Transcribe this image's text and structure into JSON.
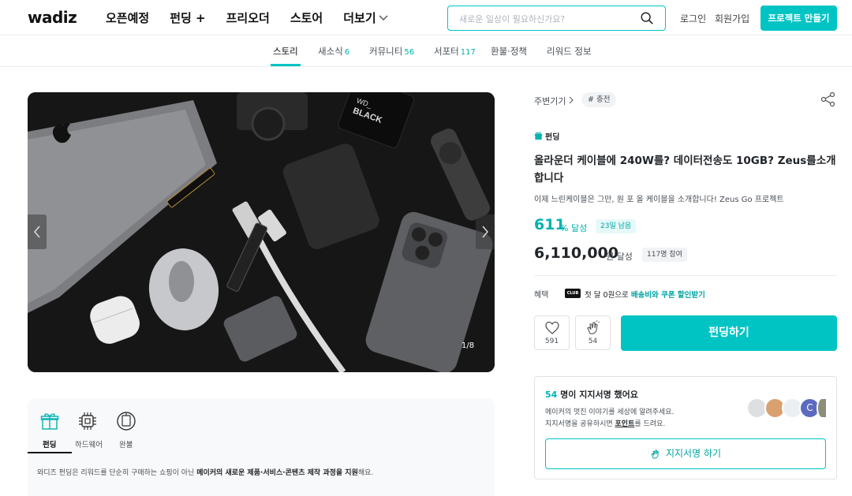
{
  "header": {
    "logo": "wadiz",
    "nav": [
      {
        "label": "오픈예정"
      },
      {
        "label": "펀딩 +"
      },
      {
        "label": "프리오더"
      },
      {
        "label": "스토어"
      },
      {
        "label": "더보기"
      }
    ],
    "search_placeholder": "새로운 일상이 필요하신가요?",
    "login": "로그인",
    "signup": "회원가입",
    "make_project": "프로젝트 만들기"
  },
  "tabs": [
    {
      "label": "스토리",
      "count": ""
    },
    {
      "label": "새소식",
      "count": "6"
    },
    {
      "label": "커뮤니티",
      "count": "56"
    },
    {
      "label": "서포터",
      "count": "117"
    },
    {
      "label": "환불·정책",
      "count": ""
    },
    {
      "label": "리워드 정보",
      "count": ""
    }
  ],
  "gallery": {
    "counter": "1/8"
  },
  "info": {
    "items": [
      {
        "label": "펀딩",
        "icon": "gift-icon"
      },
      {
        "label": "하드웨어",
        "icon": "chip-icon"
      },
      {
        "label": "완불",
        "icon": "clock-icon"
      }
    ],
    "desc_pre": "와디즈 펀딩은 리워드를 단순히 구매하는 쇼핑이 아닌 ",
    "desc_bold": "메이커의 새로운 제품·서비스·콘텐츠 제작 과정을 지원",
    "desc_post": "해요."
  },
  "project": {
    "category": "주변기기",
    "tag": "# 충전",
    "badge": "펀딩",
    "title": "올라운더 케이블에 240W를? 데이터전송도 10GB? Zeus를소개합니다",
    "subtitle": "이제 느린케이블은 그만, 원 포 올 케이블을 소개합니다! Zeus Go 프로젝트",
    "rate": "611",
    "rate_unit": "% 달성",
    "days_left": "23일 남음",
    "amount": "6,110,000",
    "amount_unit": "원 달성",
    "participants": "117명 참여",
    "benefit_label": "혜택",
    "club_badge": "CLUB",
    "benefit_text": "첫 달 0원으로 ",
    "benefit_link": "배송비와 쿠폰 할인받기",
    "likes": "591",
    "cheers": "54",
    "fund_button": "펀딩하기"
  },
  "support": {
    "count": "54",
    "title_rest": " 명이 지지서명 했어요",
    "desc1": "메이커의 멋진 이야기를 세상에 알려주세요.",
    "desc2_pre": "지지서명을 공유하시면 ",
    "desc2_bold": "포인트",
    "desc2_post": "를 드려요.",
    "avatar_letter": "C",
    "button": "지지서명 하기"
  }
}
